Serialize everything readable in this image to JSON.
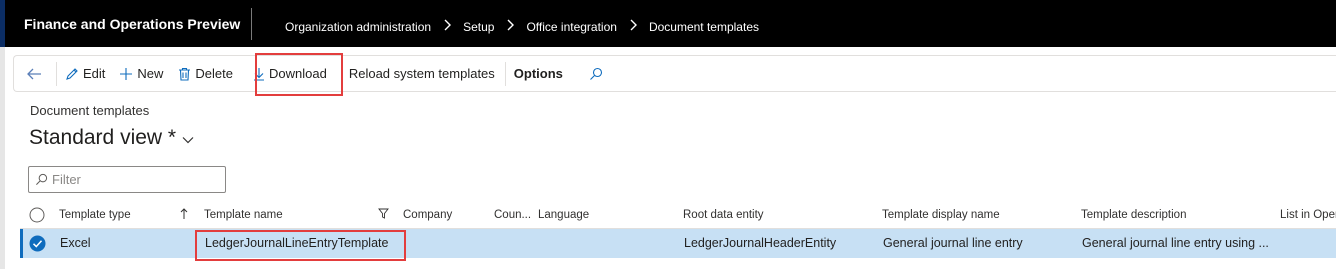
{
  "app": {
    "title": "Finance and Operations Preview"
  },
  "breadcrumb": [
    "Organization administration",
    "Setup",
    "Office integration",
    "Document templates"
  ],
  "actions": {
    "edit": "Edit",
    "new": "New",
    "delete": "Delete",
    "download": "Download",
    "reload": "Reload system templates",
    "options": "Options"
  },
  "form": {
    "caption": "Document templates",
    "view_name": "Standard view *"
  },
  "filter": {
    "placeholder": "Filter"
  },
  "grid": {
    "columns": [
      "Template type",
      "Template name",
      "Company",
      "Coun...",
      "Language",
      "Root data entity",
      "Template display name",
      "Template description",
      "List in Oper"
    ],
    "rows": [
      {
        "template_type": "Excel",
        "template_name": "LedgerJournalLineEntryTemplate",
        "company": "",
        "country": "",
        "language": "",
        "root_data_entity": "LedgerJournalHeaderEntity",
        "template_display_name": "General journal line entry",
        "template_description": "General journal line entry using ...",
        "selected": true
      }
    ]
  },
  "colors": {
    "accent": "#0f6cbd",
    "highlight": "#e33d3d",
    "selected_row": "#c7e0f4"
  }
}
